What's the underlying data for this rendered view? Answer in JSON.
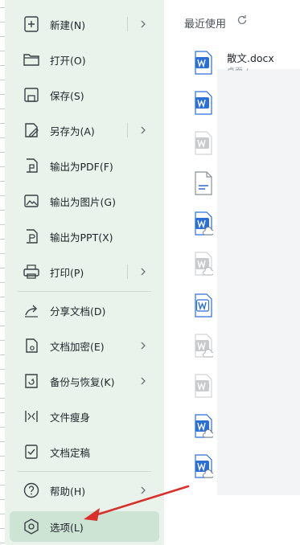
{
  "menu": {
    "items": [
      {
        "label": "新建(N)"
      },
      {
        "label": "打开(O)"
      },
      {
        "label": "保存(S)"
      },
      {
        "label": "另存为(A)"
      },
      {
        "label": "输出为PDF(F)"
      },
      {
        "label": "输出为图片(G)"
      },
      {
        "label": "输出为PPT(X)"
      },
      {
        "label": "打印(P)"
      },
      {
        "label": "分享文档(D)"
      },
      {
        "label": "文档加密(E)"
      },
      {
        "label": "备份与恢复(K)"
      },
      {
        "label": "文件瘦身"
      },
      {
        "label": "文档定稿"
      },
      {
        "label": "帮助(H)"
      },
      {
        "label": "选项(L)"
      }
    ]
  },
  "recent": {
    "title": "最近使用",
    "first_file": {
      "name": "散文.docx",
      "location": "桌面 /"
    },
    "file_icons": [
      "word-doc-icon-blue",
      "word-doc-icon-blue",
      "word-doc-icon-gray",
      "generic-doc-icon",
      "word-cloud-icon-blue",
      "word-cloud-icon-gray",
      "word-doc-icon-outline",
      "word-cloud-icon-gray",
      "word-doc-icon-gray",
      "word-cloud-icon-blue",
      "word-cloud-icon-blue"
    ]
  },
  "colors": {
    "menu_bg": "#e9f3ec",
    "selected_bg": "#cde3d4",
    "word_blue": "#2b6fd6",
    "icon_gray": "#c8cacc",
    "arrow_red": "#d9302c"
  }
}
